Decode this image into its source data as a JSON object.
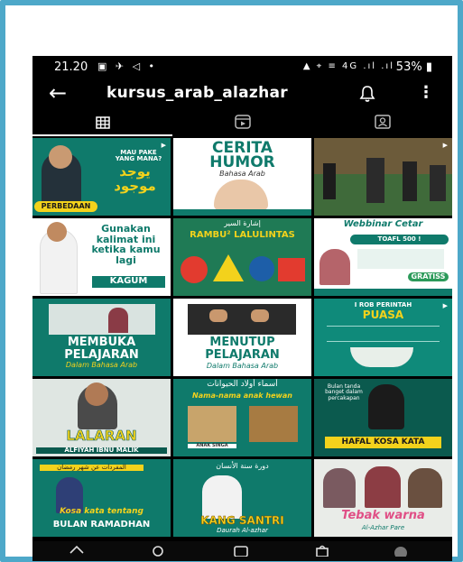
{
  "status_bar": {
    "time": "21.20",
    "left_icons": "▣ ✈ ◁ •",
    "right_icons": "▲ ⌖ ≡ 4G .ıl .ıl",
    "battery": "53%"
  },
  "header": {
    "username": "kursus_arab_alazhar"
  },
  "tabs": [
    {
      "name": "grid"
    },
    {
      "name": "reels"
    },
    {
      "name": "tagged"
    }
  ],
  "posts": [
    {
      "top": "MAU PAKE YANG MANA?",
      "main": "يوجد موجود",
      "bottom": "PERBEDAAN"
    },
    {
      "top": "CERITA",
      "main": "HUMOR",
      "bottom": "Bahasa Arab"
    },
    {
      "top": "",
      "main": "",
      "bottom": ""
    },
    {
      "top": "Gunakan kalimat ini ketika kamu lagi",
      "main": "KAGUM",
      "bottom": ""
    },
    {
      "top": "إشارة السير",
      "main": "RAMBU² LALULINTAS",
      "bottom": ""
    },
    {
      "top": "Webbinar Cetar",
      "main": "TOAFL 500 !",
      "bottom": "GRATISS"
    },
    {
      "top": "",
      "main": "MEMBUKA PELAJARAN",
      "bottom": "Dalam Bahasa Arab"
    },
    {
      "top": "",
      "main": "MENUTUP PELAJARAN",
      "bottom": "Dalam Bahasa Arab"
    },
    {
      "top": "I ROB PERINTAH",
      "main": "PUASA",
      "bottom": ""
    },
    {
      "top": "",
      "main": "LALARAN",
      "bottom": "ALFIYAH IBNU MALIK"
    },
    {
      "top": "أسماء أولاد الحيوانات",
      "main": "Nama-nama anak hewan",
      "bottom": "ANAK SINGA"
    },
    {
      "top": "Bulan tanda banget dalam percakapan",
      "main": "HAFAL KOSA KATA",
      "bottom": ""
    },
    {
      "top": "المفردات عن شهر رمضان",
      "main": "Kosa kata tentang",
      "bottom": "BULAN RAMADHAN"
    },
    {
      "top": "دورة سنة الأنسان",
      "main": "KANG SANTRI",
      "bottom": "Daurah Al-azhar"
    },
    {
      "top": "",
      "main": "Tebak warna",
      "bottom": "Al-Azhar Pare"
    }
  ],
  "colors": {
    "frame": "#4ea8c9",
    "teal": "#0f7a6b",
    "dark_teal": "#0b5a4e",
    "yellow": "#f3d21c"
  }
}
